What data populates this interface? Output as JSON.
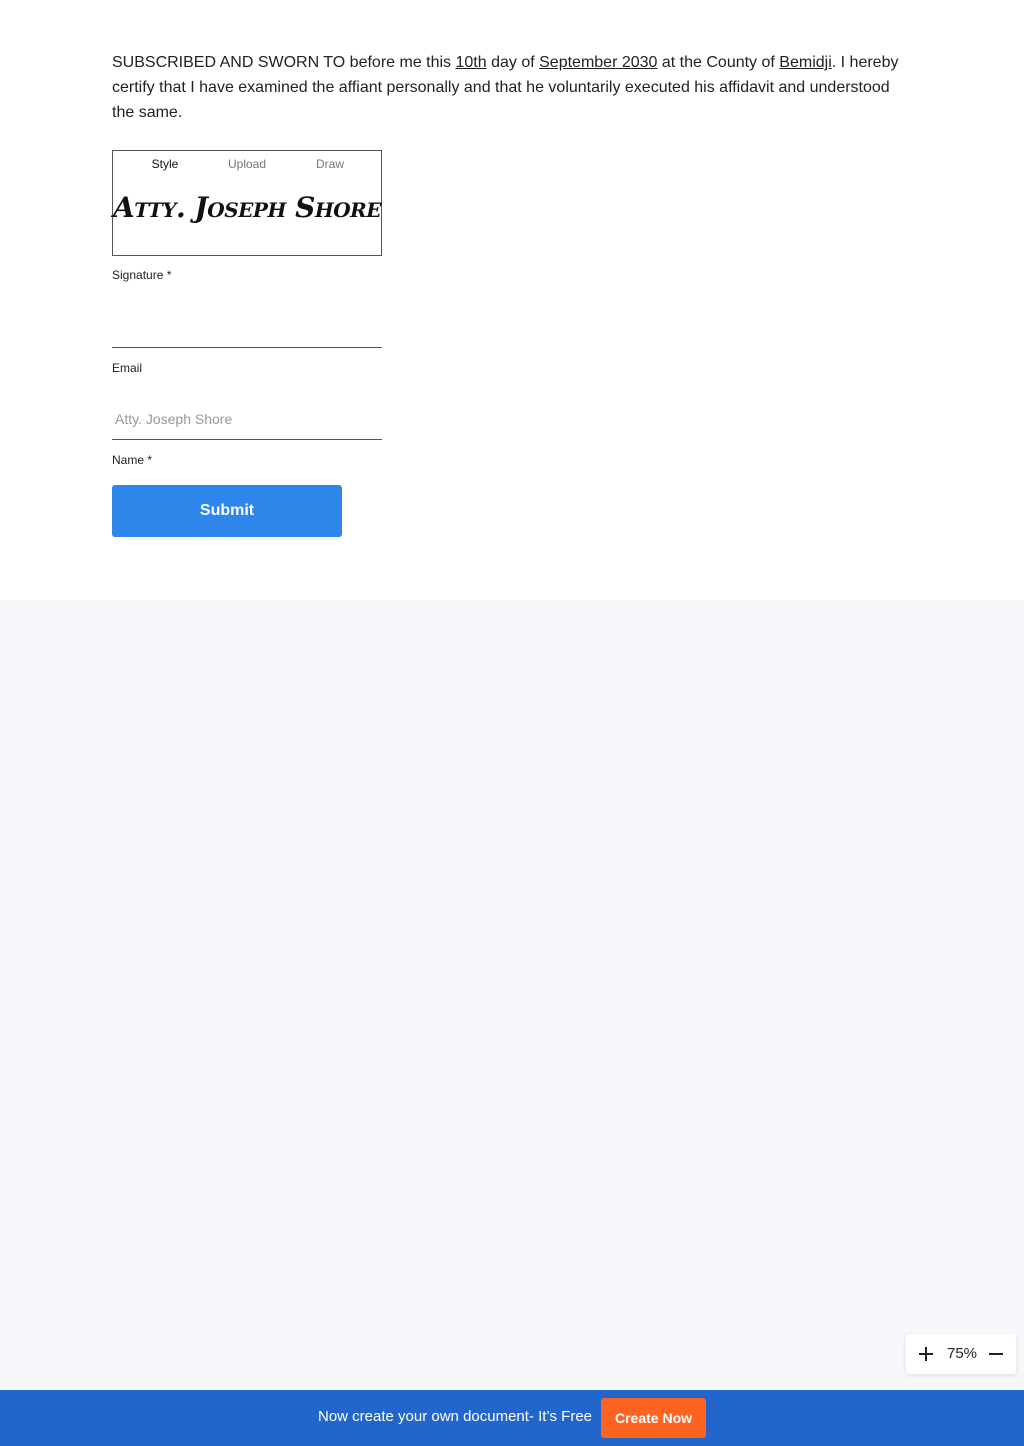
{
  "affidavit": {
    "part1": "SUBSCRIBED AND SWORN TO before me this ",
    "day": "10th",
    "part2": " day of ",
    "month_year": "September 2030",
    "part3": " at the County of ",
    "county": "Bemidji",
    "part4": ". I hereby certify that I have examined the affiant personally and that he voluntarily executed his affidavit and understood the same."
  },
  "signature_widget": {
    "tabs": [
      {
        "label": "Style",
        "active": true
      },
      {
        "label": "Upload",
        "active": false
      },
      {
        "label": "Draw",
        "active": false
      }
    ],
    "preview_text": "Atty. Joseph Shore"
  },
  "form": {
    "signature_label": "Signature *",
    "email_label": "Email",
    "email_value": "",
    "name_placeholder": "Atty. Joseph Shore",
    "name_value": "",
    "name_label": "Name *",
    "submit_label": "Submit"
  },
  "zoom": {
    "level": "75%",
    "plus_icon": "plus-icon",
    "minus_icon": "minus-icon"
  },
  "promo": {
    "text": "Now create your own document- It’s Free",
    "button_label": "Create Now",
    "bar_color": "#2266cc",
    "button_color": "#ff6321"
  },
  "colors": {
    "primary_button": "#2e86ea",
    "page_background": "#f6f8fb"
  }
}
